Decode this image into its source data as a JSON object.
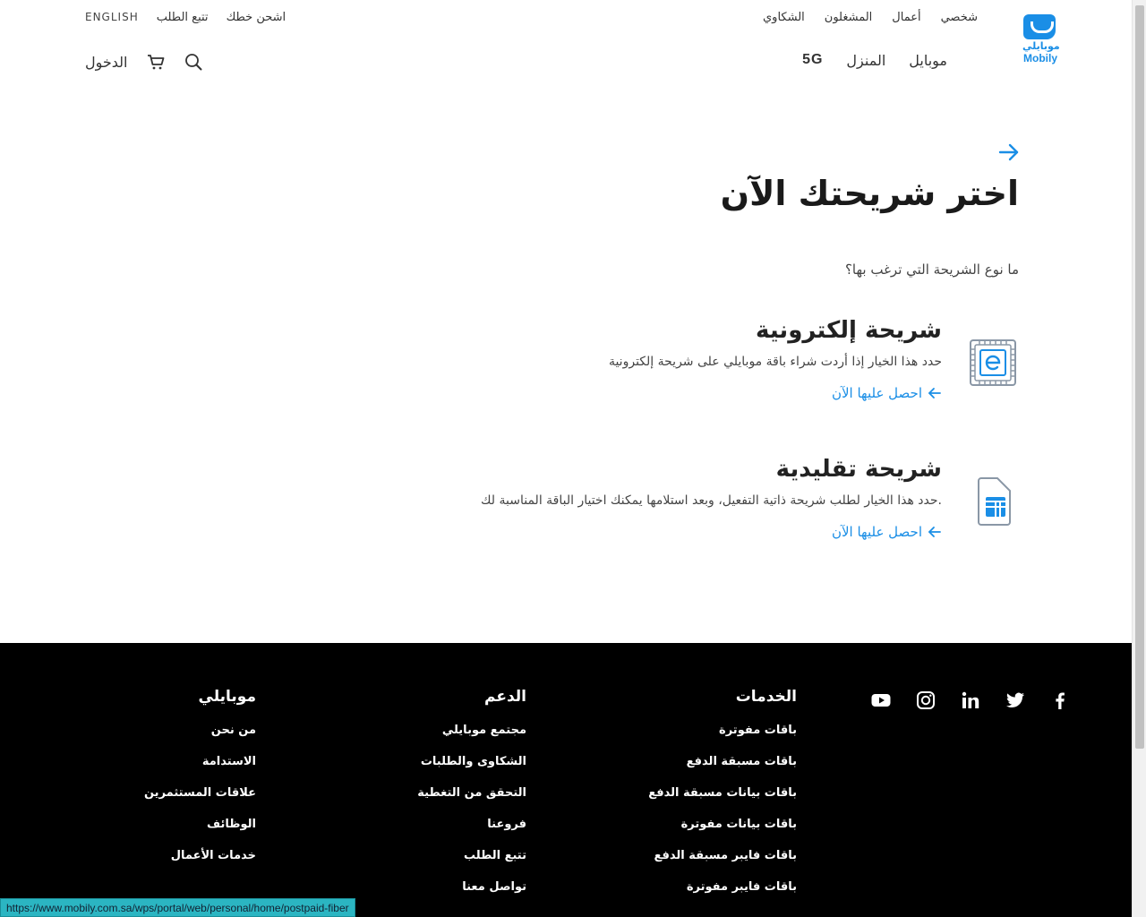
{
  "header": {
    "top_right_links": [
      "شخصي",
      "أعمال",
      "المشغلون",
      "الشكاوي"
    ],
    "top_left_links": [
      "اشحن خطك",
      "تتبع الطلب",
      "ENGLISH"
    ],
    "logo_ar": "موبايلي",
    "logo_en": "Mobily",
    "main_nav": [
      "موبايل",
      "المنزل",
      "5G"
    ],
    "login_label": "الدخول"
  },
  "main": {
    "title": "اختر شريحتك الآن",
    "question": "ما نوع الشريحة التي ترغب بها؟",
    "options": [
      {
        "title": "شريحة إلكترونية",
        "description": "حدد هذا الخيار إذا أردت شراء باقة موبايلي على شريحة إلكترونية",
        "link": "احصل عليها الآن",
        "icon": "esim-icon"
      },
      {
        "title": "شريحة تقليدية",
        "description": "حدد هذا الخيار لطلب شريحة ذاتية التفعيل، وبعد استلامها يمكنك اختيار الباقة المناسبة لك.",
        "link": "احصل عليها الآن",
        "icon": "sim-card-icon"
      }
    ]
  },
  "footer": {
    "social": [
      "facebook-icon",
      "twitter-icon",
      "linkedin-icon",
      "instagram-icon",
      "youtube-icon"
    ],
    "columns": [
      {
        "heading": "الخدمات",
        "links": [
          "باقات مفوترة",
          "باقات مسبقة الدفع",
          "باقات بيانات مسبقة الدفع",
          "باقات بيانات مفوترة",
          "باقات فايبر مسبقة الدفع",
          "باقات فايبر مفوترة"
        ]
      },
      {
        "heading": "الدعم",
        "links": [
          "مجتمع موبايلي",
          "الشكاوى والطلبات",
          "التحقق من التغطية",
          "فروعنا",
          "تتبع الطلب",
          "تواصل معنا"
        ]
      },
      {
        "heading": "موبايلي",
        "links": [
          "من نحن",
          "الاستدامة",
          "علاقات المستثمرين",
          "الوظائف",
          "خدمات الأعمال"
        ]
      }
    ]
  },
  "status_bar_url": "https://www.mobily.com.sa/wps/portal/web/personal/home/postpaid-fiber",
  "colors": {
    "accent": "#1a8ee6",
    "footer_bg": "#000000",
    "status_bar": "#2bb5c2"
  }
}
